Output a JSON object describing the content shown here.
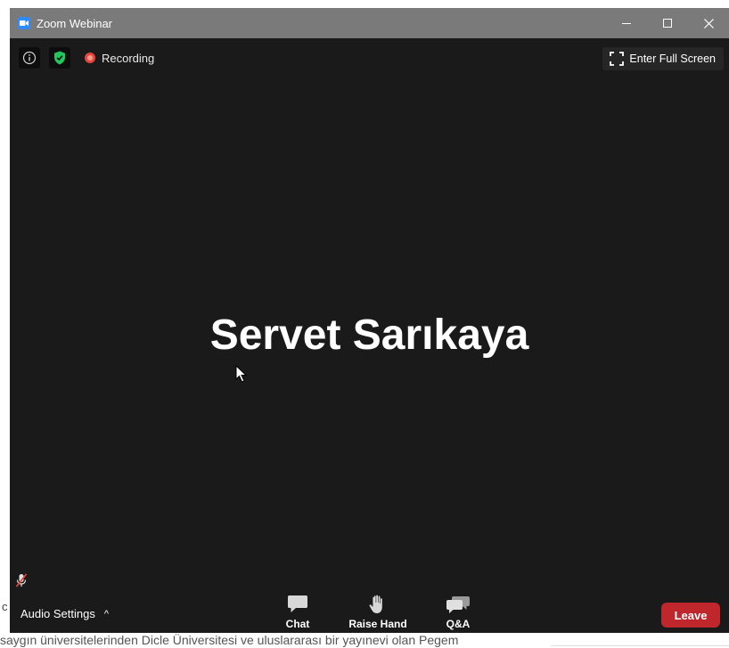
{
  "window": {
    "title": "Zoom Webinar"
  },
  "top_strip": {
    "recording_label": "Recording",
    "fullscreen_label": "Enter Full Screen"
  },
  "main": {
    "speaker_name": "Servet Sarıkaya"
  },
  "toolbar": {
    "audio_settings_label": "Audio Settings",
    "audio_caret": "^",
    "chat_label": "Chat",
    "raise_hand_label": "Raise Hand",
    "qa_label": "Q&A",
    "leave_label": "Leave"
  },
  "background": {
    "bottom_text": "saygın üniversitelerinden Dicle Üniversitesi ve uluslararası bir yayınevi olan Pegem",
    "left_char": "c"
  },
  "colors": {
    "accent": "#2d8cff",
    "recording": "#e8453c",
    "shield": "#22c55e",
    "leave": "#c0272d",
    "background": "#1a1a1a"
  },
  "icons": {
    "title": "zoom-logo-icon",
    "info": "info-icon",
    "security": "shield-check-icon",
    "recording": "recording-dot-icon",
    "fullscreen": "fullscreen-icon",
    "mute": "muted-mic-icon",
    "chat": "chat-icon",
    "raise_hand": "hand-icon",
    "qa": "qa-icon"
  }
}
